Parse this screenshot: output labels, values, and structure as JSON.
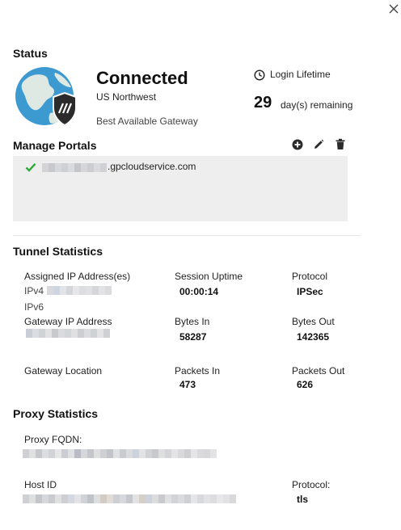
{
  "window": {
    "close_icon": "close-icon"
  },
  "status": {
    "title": "Status",
    "state": "Connected",
    "location": "US Northwest",
    "gateway_note": "Best Available Gateway",
    "login_lifetime_label": "Login Lifetime",
    "days_value": "29",
    "days_suffix": "day(s) remaining",
    "globe_icon": "globe-shield-icon"
  },
  "portals": {
    "title": "Manage Portals",
    "actions": {
      "add": "add-icon",
      "edit": "edit-icon",
      "delete": "delete-icon"
    },
    "items": [
      {
        "name_suffix": ".gpcloudservice.com",
        "status": "connected"
      }
    ]
  },
  "tunnel": {
    "title": "Tunnel Statistics",
    "assigned_ip_label": "Assigned IP Address(es)",
    "ipv4_label": "IPv4",
    "ipv6_label": "IPv6",
    "gateway_ip_label": "Gateway IP Address",
    "gateway_location_label": "Gateway Location",
    "session_uptime_label": "Session Uptime",
    "session_uptime_value": "00:00:14",
    "bytes_in_label": "Bytes In",
    "bytes_in_value": "58287",
    "packets_in_label": "Packets In",
    "packets_in_value": "473",
    "protocol_label": "Protocol",
    "protocol_value": "IPSec",
    "bytes_out_label": "Bytes Out",
    "bytes_out_value": "142365",
    "packets_out_label": "Packets Out",
    "packets_out_value": "626"
  },
  "proxy": {
    "title": "Proxy Statistics",
    "fqdn_label": "Proxy FQDN:",
    "host_id_label": "Host ID",
    "protocol_label": "Protocol:",
    "protocol_value": "tls"
  },
  "colors": {
    "accent_green": "#2eaa3a",
    "globe_ocean": "#3d9ad1",
    "globe_land": "#dfe9e3",
    "panel_bg": "#eeeeee"
  }
}
